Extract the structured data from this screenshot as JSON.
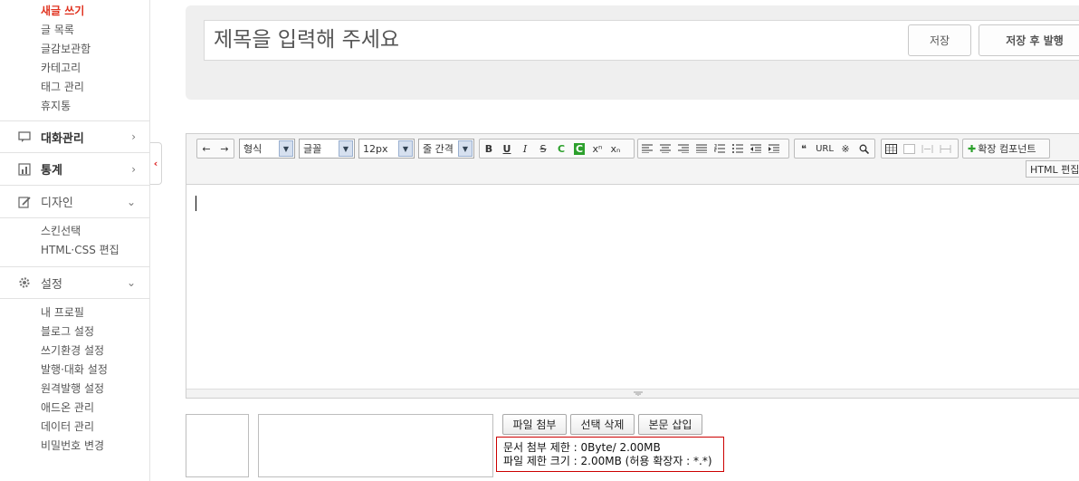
{
  "sidebar": {
    "write_items": [
      "새글 쓰기",
      "글 목록",
      "글감보관함",
      "카테고리",
      "태그 관리",
      "휴지통"
    ],
    "sections": [
      {
        "label": "대화관리",
        "arrow": "›",
        "icon": "comment-icon"
      },
      {
        "label": "통계",
        "arrow": "›",
        "icon": "chart-icon"
      },
      {
        "label": "디자인",
        "arrow": "⌄",
        "icon": "design-icon"
      }
    ],
    "design_items": [
      "스킨선택",
      "HTML·CSS 편집"
    ],
    "settings": {
      "label": "설정",
      "arrow": "⌄",
      "icon": "gear-icon"
    },
    "settings_items": [
      "내 프로필",
      "블로그 설정",
      "쓰기환경 설정",
      "발행·대화 설정",
      "원격발행 설정",
      "애드온 관리",
      "데이터 관리",
      "비밀번호 변경"
    ],
    "collapse_glyph": "‹"
  },
  "title": {
    "placeholder": "제목을 입력해 주세요"
  },
  "buttons": {
    "save": "저장",
    "save_publish": "저장 후 발행"
  },
  "toolbar": {
    "undo": "←",
    "redo": "→",
    "format": "형식",
    "font": "글꼴",
    "size": "12px",
    "line_height": "줄 간격",
    "bold": "B",
    "underline": "U",
    "italic": "I",
    "strike": "S",
    "color": "C",
    "bgcolor": "C",
    "superscript": "xⁿ",
    "subscript": "xₙ",
    "quote": "❝",
    "url": "URL",
    "special": "※",
    "find": "🔍",
    "extend": "확장 컴포넌트",
    "extend_plus": "✚",
    "html_edit": "HTML 편집",
    "dropdown_glyph": "▼"
  },
  "attachment": {
    "attach_button": "파일 첨부",
    "delete_button": "선택 삭제",
    "insert_button": "본문 삽입",
    "limit_line1": "문서 첨부 제한 : 0Byte/ 2.00MB",
    "limit_line2": "파일 제한 크기 : 2.00MB (허용 확장자 : *.*)"
  },
  "colors": {
    "accent_red": "#e0321f",
    "green": "#2ca02c"
  }
}
